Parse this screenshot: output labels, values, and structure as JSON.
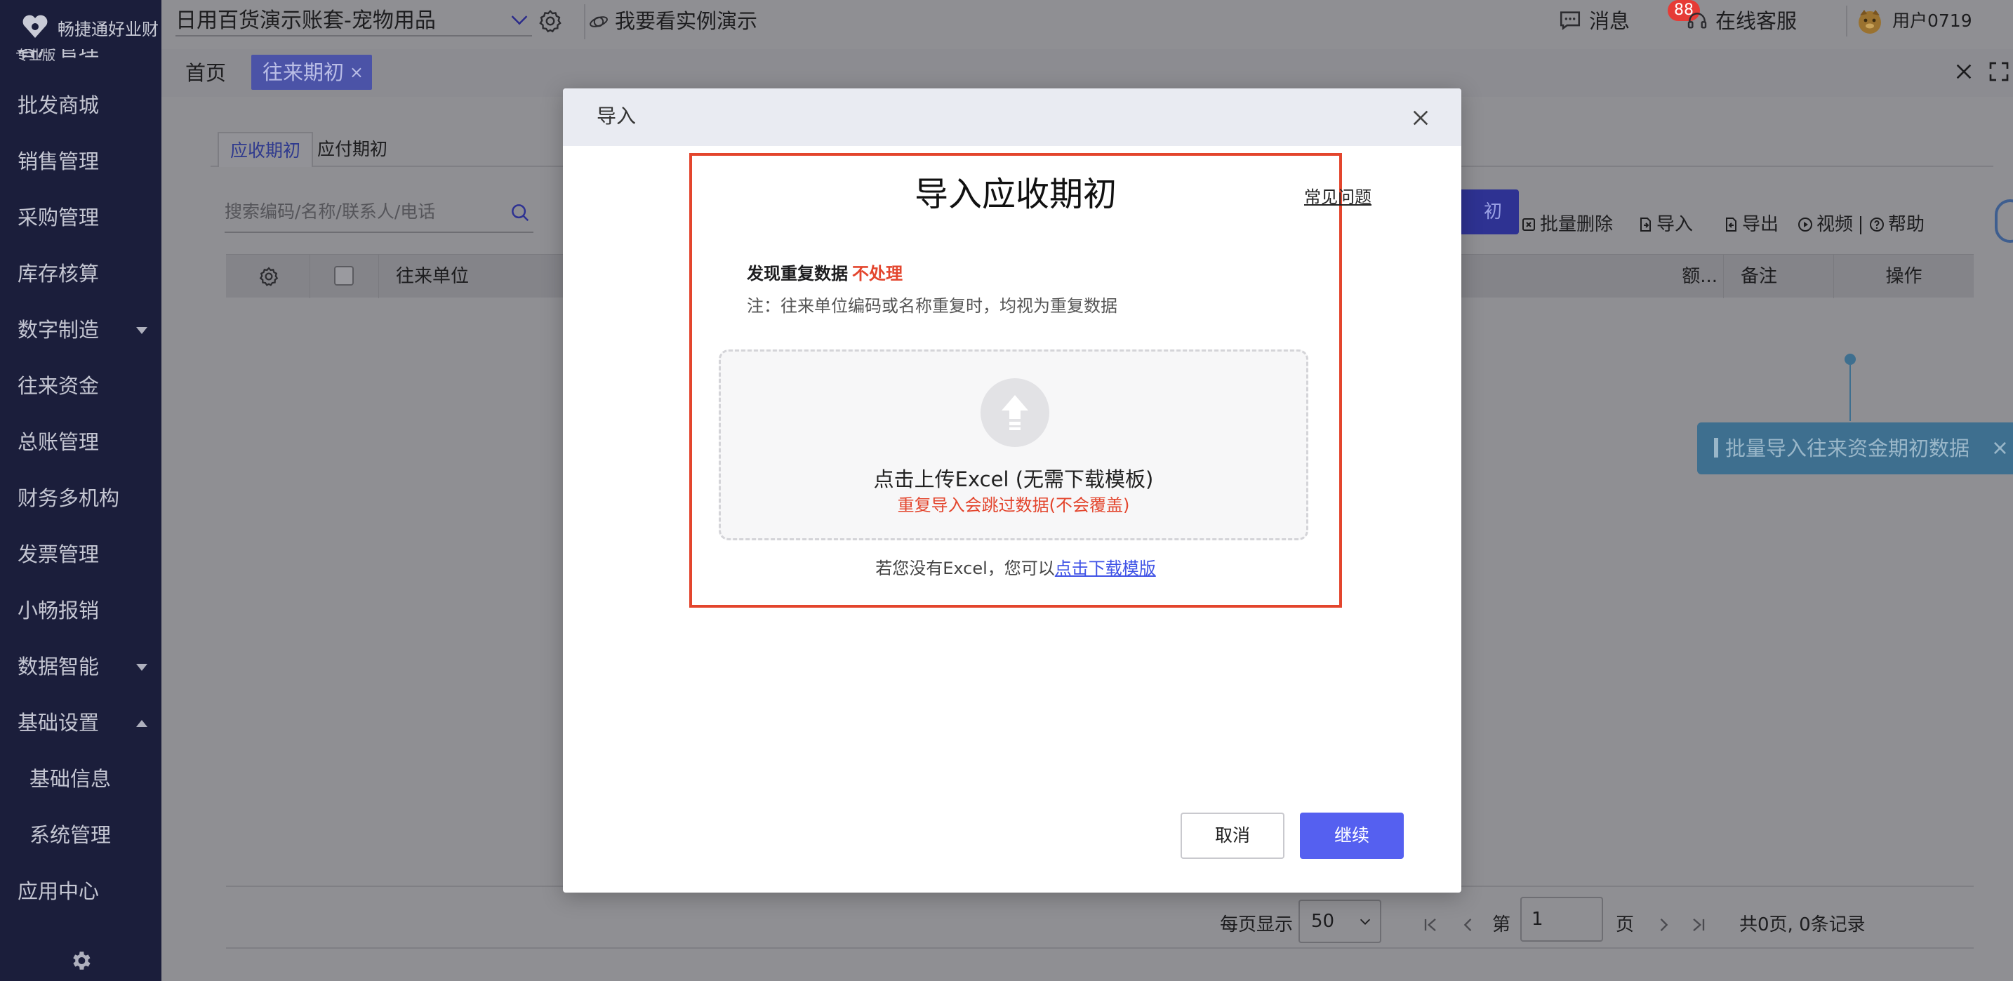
{
  "brand": {
    "name": "畅捷通好业财",
    "edition": "专业版"
  },
  "sidebar": {
    "items": [
      {
        "label": "客户管理",
        "clipped": true
      },
      {
        "label": "批发商城"
      },
      {
        "label": "销售管理"
      },
      {
        "label": "采购管理"
      },
      {
        "label": "库存核算"
      },
      {
        "label": "数字制造",
        "caret": "down"
      },
      {
        "label": "往来资金"
      },
      {
        "label": "总账管理"
      },
      {
        "label": "财务多机构"
      },
      {
        "label": "发票管理"
      },
      {
        "label": "小畅报销"
      },
      {
        "label": "数据智能",
        "caret": "down"
      },
      {
        "label": "基础设置",
        "caret": "up"
      },
      {
        "label": "基础信息",
        "sub": true
      },
      {
        "label": "系统管理",
        "sub": true
      },
      {
        "label": "应用中心"
      }
    ],
    "settings_icon": "gear-icon"
  },
  "topbar": {
    "account": "日用百货演示账套-宠物用品",
    "demo_link": "我要看实例演示",
    "messages_label": "消息",
    "messages_count": "88",
    "service_label": "在线客服",
    "user_label": "用户0719"
  },
  "tabs": {
    "home": "首页",
    "active": "往来期初",
    "active_close": "×"
  },
  "page": {
    "subtabs": [
      "应收期初",
      "应付期初"
    ],
    "search_placeholder": "搜索编码/名称/联系人/电话",
    "partial_button": "初",
    "toolbar": {
      "batch_delete": "批量删除",
      "import": "导入",
      "export": "导出",
      "video": "视频",
      "help": "帮助"
    },
    "columns": {
      "partner": "往来单位",
      "amount_truncated": "额...",
      "remark": "备注",
      "operation": "操作"
    },
    "tooltip": "批量导入往来资金期初数据",
    "tooltip_close": "×",
    "pager": {
      "per_page_label": "每页显示",
      "per_page_value": "50",
      "page_prefix": "第",
      "page_value": "1",
      "page_suffix": "页",
      "summary": "共0页, 0条记录"
    }
  },
  "modal": {
    "title": "导入",
    "heading": "导入应收期初",
    "faq_link": "常见问题",
    "duplicate_label": "发现重复数据",
    "duplicate_value": "不处理",
    "note": "注：往来单位编码或名称重复时，均视为重复数据",
    "upload_text": "点击上传Excel (无需下载模板)",
    "upload_warning": "重复导入会跳过数据(不会覆盖)",
    "no_excel_text": "若您没有Excel，您可以",
    "download_link": "点击下载模版",
    "cancel_button": "取消",
    "continue_button": "继续"
  },
  "colors": {
    "sidebar_bg": "#1b1e3b",
    "accent": "#5560f0",
    "danger": "#e3452d",
    "link": "#3f52e6"
  }
}
